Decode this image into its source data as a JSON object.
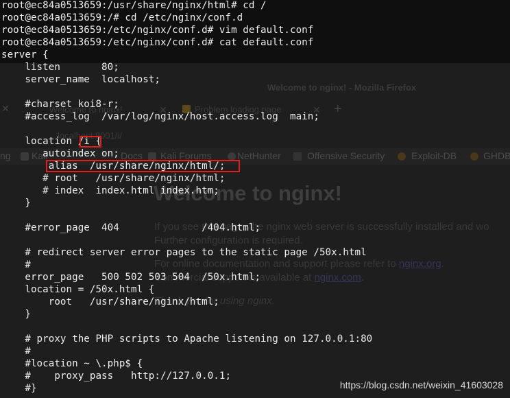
{
  "terminal": {
    "lines": [
      "root@ec84a0513659:/usr/share/nginx/html# cd /",
      "root@ec84a0513659:/# cd /etc/nginx/conf.d",
      "root@ec84a0513659:/etc/nginx/conf.d# vim default.conf",
      "root@ec84a0513659:/etc/nginx/conf.d# cat default.conf",
      "server {",
      "    listen       80;",
      "    server_name  localhost;",
      "",
      "    #charset koi8-r;",
      "    #access_log  /var/log/nginx/host.access.log  main;",
      "",
      "    location /i {",
      "       autoindex on;",
      "        alias  /usr/share/nginx/html/;",
      "       # root   /usr/share/nginx/html;",
      "       # index  index.html index.htm;",
      "    }",
      "",
      "    #error_page  404              /404.html;",
      "",
      "    # redirect server error pages to the static page /50x.html",
      "    #",
      "    error_page   500 502 503 504  /50x.html;",
      "    location = /50x.html {",
      "        root   /usr/share/nginx/html;",
      "    }",
      "",
      "    # proxy the PHP scripts to Apache listening on 127.0.0.1:80",
      "    #",
      "    #location ~ \\.php$ {",
      "    #    proxy_pass   http://127.0.0.1;",
      "    #}"
    ]
  },
  "browser": {
    "window_title": "Welcome to nginx! - Mozilla Firefox",
    "tabs": [
      {
        "label": "Welcome to nginx!"
      },
      {
        "label": "Problem loading page"
      }
    ],
    "url": "localhost:8001/i/",
    "bookmarks": [
      "ng",
      "Kali",
      "Docs",
      "Kali Forums",
      "NetHunter",
      "Offensive Security",
      "Exploit-DB",
      "GHDB"
    ],
    "page": {
      "heading": "Welcome to nginx!",
      "line1": "If you see this page, the nginx web server is successfully installed and wo",
      "line2": "Further configuration is required.",
      "line3_text": "For online documentation and support please refer to ",
      "line3_link": "nginx.org",
      "line4_text": "Commercial support is available at ",
      "line4_link": "nginx.com",
      "thanks": "Thank you for using nginx."
    }
  },
  "watermark": "https://blog.csdn.net/weixin_41603028",
  "colors": {
    "terminal_text": "#ededed",
    "highlight_border": "#e0201c",
    "background": "#1d1d1d"
  }
}
